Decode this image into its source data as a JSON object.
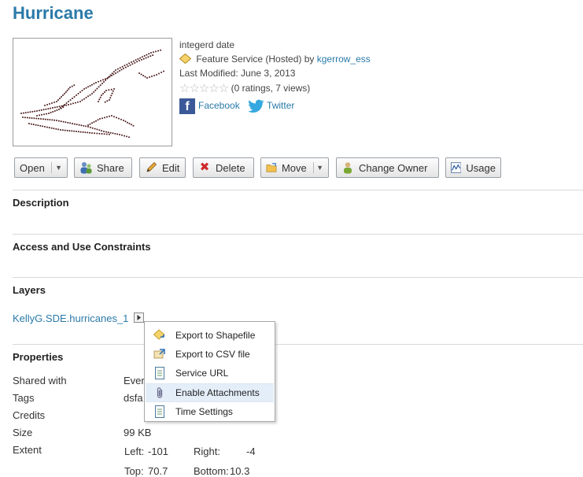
{
  "title": "Hurricane",
  "item": {
    "name": "integerd date",
    "type_text": "Feature Service (Hosted) by",
    "owner": "kgerrow_ess",
    "last_modified": "Last Modified: June 3, 2013",
    "ratings_text": "(0 ratings, 7 views)",
    "rating_stars": 0,
    "facebook_label": "Facebook",
    "twitter_label": "Twitter"
  },
  "toolbar": {
    "open": "Open",
    "share": "Share",
    "edit": "Edit",
    "delete": "Delete",
    "move": "Move",
    "change_owner": "Change Owner",
    "usage": "Usage"
  },
  "sections": {
    "description": "Description",
    "access": "Access and Use Constraints",
    "layers": "Layers",
    "properties": "Properties"
  },
  "layer": {
    "name": "KellyG.SDE.hurricanes_1"
  },
  "context_menu": {
    "items": [
      {
        "label": "Export to Shapefile",
        "icon": "shapefile-export-icon"
      },
      {
        "label": "Export to CSV file",
        "icon": "csv-export-icon"
      },
      {
        "label": "Service URL",
        "icon": "document-icon"
      },
      {
        "label": "Enable Attachments",
        "icon": "paperclip-icon"
      },
      {
        "label": "Time Settings",
        "icon": "document-icon"
      }
    ],
    "highlighted_index": 3
  },
  "properties": {
    "shared_with_label": "Shared with",
    "shared_with_value": "Ever",
    "tags_label": "Tags",
    "tags_value": "dsfa",
    "credits_label": "Credits",
    "size_label": "Size",
    "size_value": "99 KB",
    "extent_label": "Extent",
    "extent": {
      "left_label": "Left:",
      "left": "-101",
      "right_label": "Right:",
      "right": "-4",
      "top_label": "Top:",
      "top": "70.7",
      "bottom_label": "Bottom:",
      "bottom": "10.3"
    }
  },
  "colors": {
    "title": "#2a7aa8",
    "link": "#2a7aa8",
    "menu_highlight": "#e4eef9",
    "track_points": "#4a1a1a"
  }
}
